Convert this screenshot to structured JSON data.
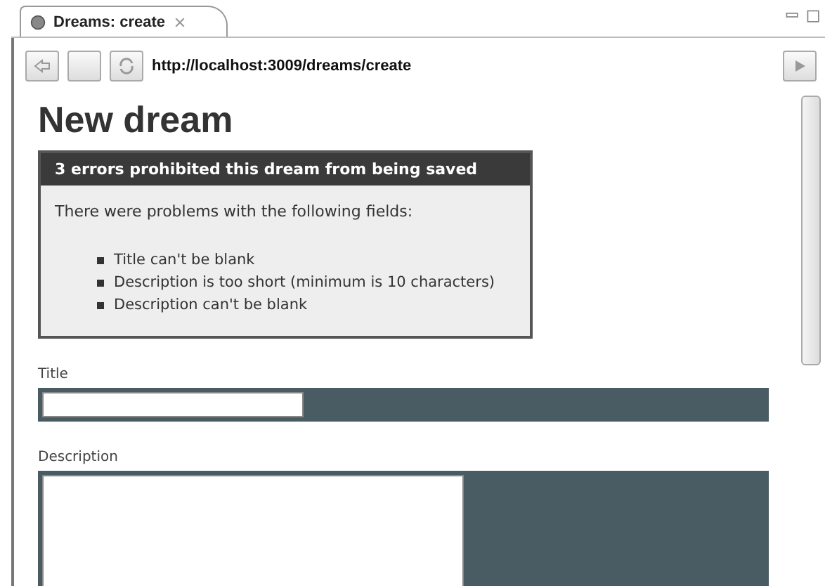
{
  "tab": {
    "title": "Dreams: create"
  },
  "toolbar": {
    "url": "http://localhost:3009/dreams/create"
  },
  "page": {
    "heading": "New dream",
    "error_box": {
      "title": "3 errors prohibited this dream from being saved",
      "intro": "There were problems with the following fields:",
      "items": [
        "Title can't be blank",
        "Description is too short (minimum is 10 characters)",
        "Description can't be blank"
      ]
    },
    "fields": [
      {
        "label": "Title",
        "kind": "text"
      },
      {
        "label": "Description",
        "kind": "textarea"
      }
    ]
  }
}
